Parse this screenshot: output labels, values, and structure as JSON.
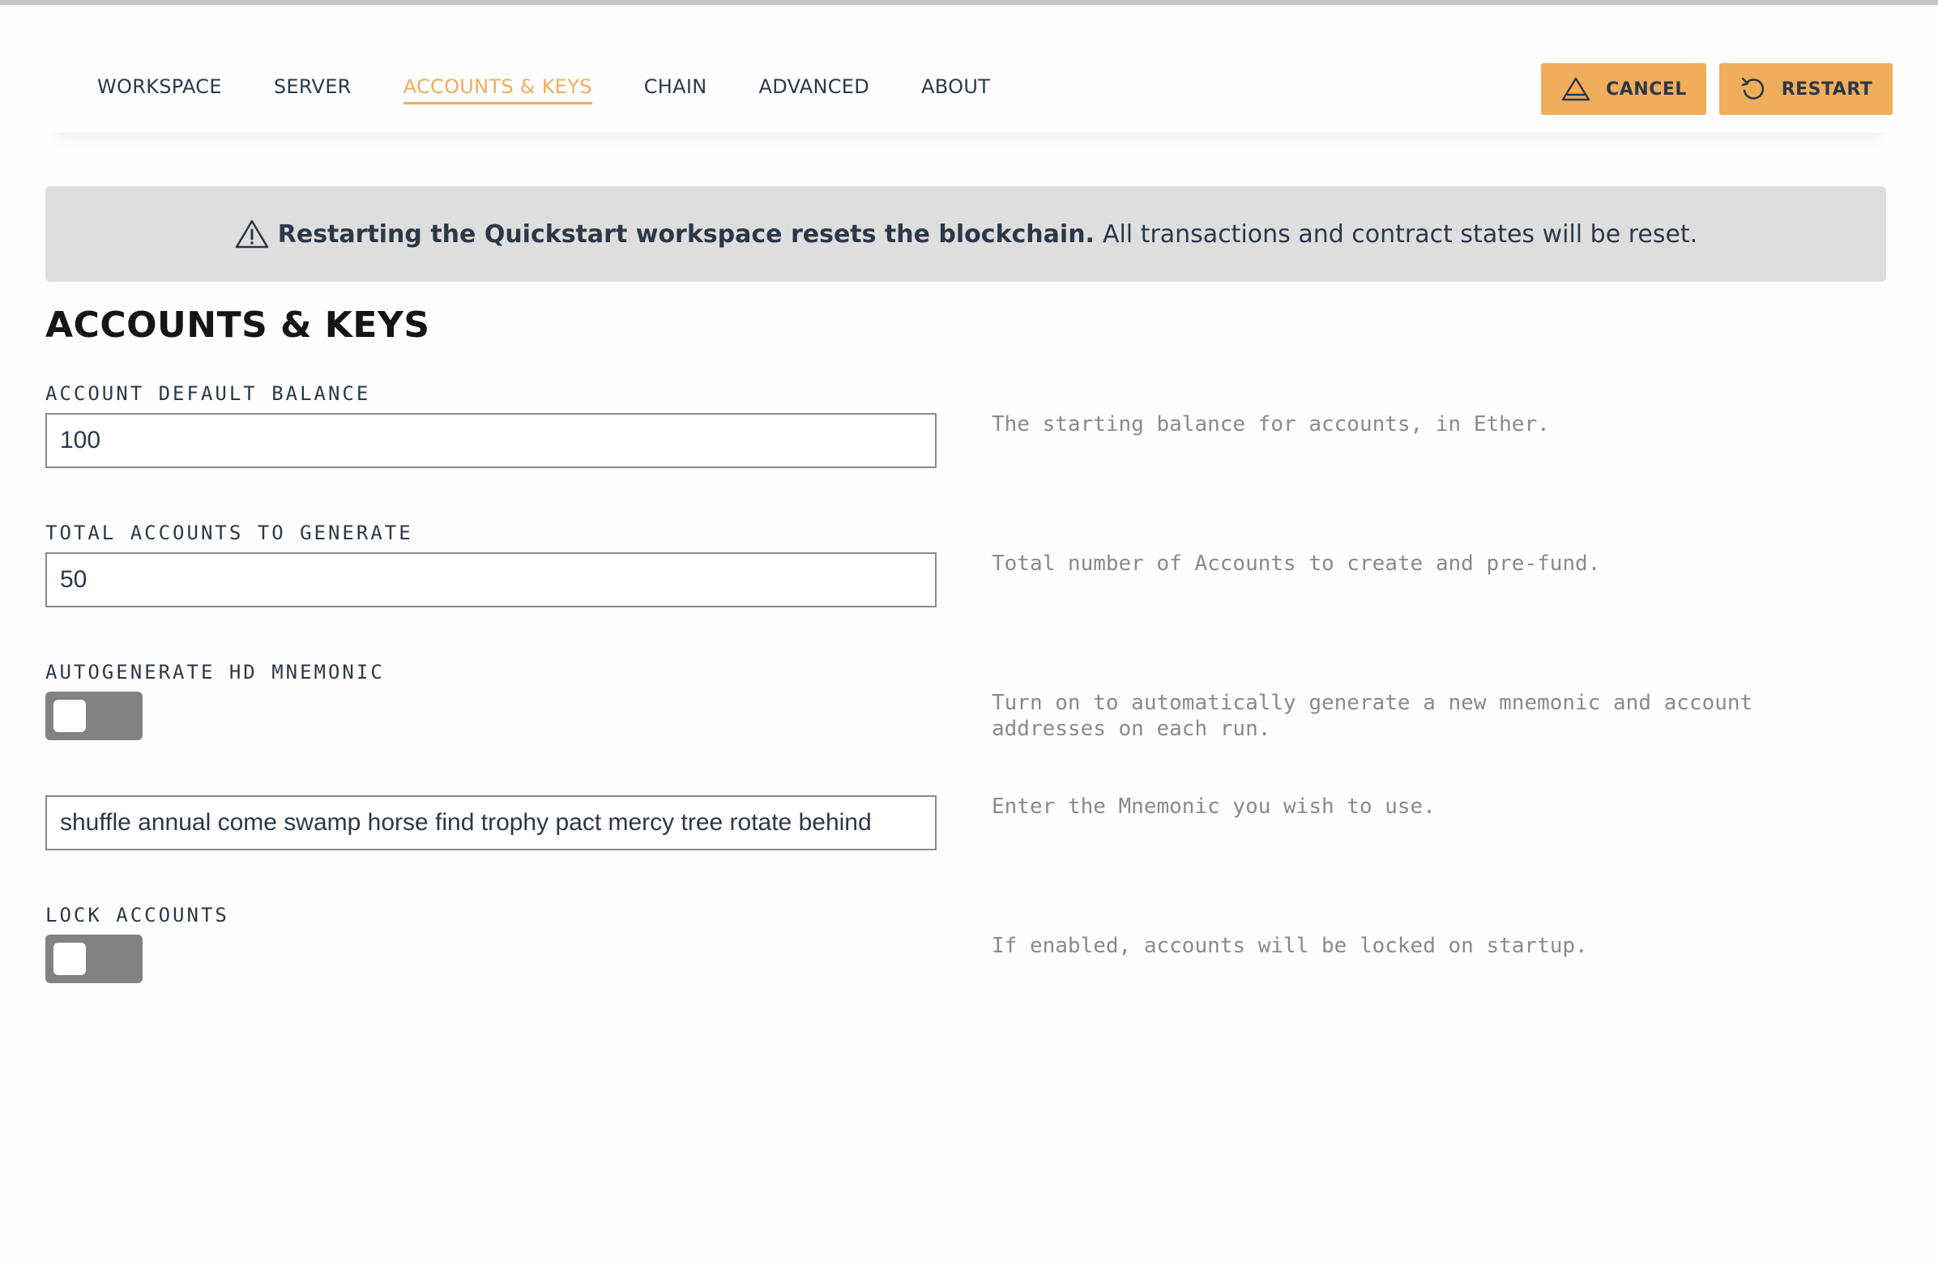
{
  "nav": {
    "tabs": [
      {
        "label": "WORKSPACE"
      },
      {
        "label": "SERVER"
      },
      {
        "label": "ACCOUNTS & KEYS"
      },
      {
        "label": "CHAIN"
      },
      {
        "label": "ADVANCED"
      },
      {
        "label": "ABOUT"
      }
    ],
    "active_tab": "ACCOUNTS & KEYS",
    "cancel_label": "CANCEL",
    "restart_label": "RESTART"
  },
  "banner": {
    "bold": "Restarting the Quickstart workspace resets the blockchain.",
    "text": "All transactions and contract states will be reset."
  },
  "section": {
    "title": "ACCOUNTS & KEYS"
  },
  "fields": {
    "balance": {
      "label": "ACCOUNT DEFAULT BALANCE",
      "value": "100",
      "help": "The starting balance for accounts, in Ether."
    },
    "total_accounts": {
      "label": "TOTAL ACCOUNTS TO GENERATE",
      "value": "50",
      "help": "Total number of Accounts to create and pre-fund."
    },
    "autogenerate": {
      "label": "AUTOGENERATE HD MNEMONIC",
      "enabled": false,
      "help": "Turn on to automatically generate a new mnemonic and account addresses on each run."
    },
    "mnemonic": {
      "value": "shuffle annual come swamp horse find trophy pact mercy tree rotate behind",
      "help": "Enter the Mnemonic you wish to use."
    },
    "lock_accounts": {
      "label": "LOCK ACCOUNTS",
      "enabled": false,
      "help": "If enabled, accounts will be locked on startup."
    }
  },
  "colors": {
    "accent": "#f0ad5c",
    "text": "#2c3848",
    "banner_bg": "#dedede",
    "toggle_off": "#828282",
    "help_text": "#8a8a8a"
  },
  "icons": {
    "cancel": "warning-triangle-icon",
    "restart": "restart-arrow-icon",
    "banner": "warning-triangle-icon"
  }
}
